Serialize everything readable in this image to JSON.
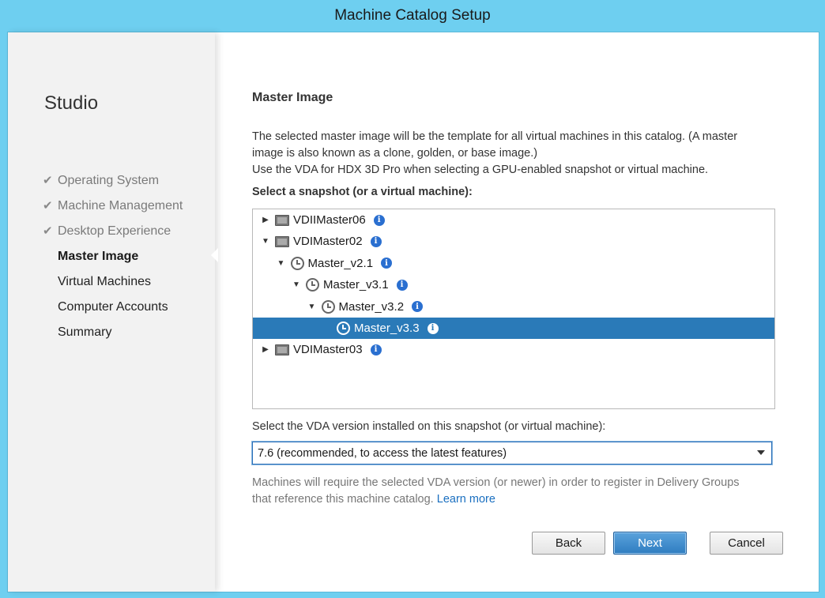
{
  "window": {
    "title": "Machine Catalog Setup"
  },
  "sidebar": {
    "app_name": "Studio",
    "steps": [
      {
        "label": "Operating System",
        "state": "done"
      },
      {
        "label": "Machine Management",
        "state": "done"
      },
      {
        "label": "Desktop Experience",
        "state": "done"
      },
      {
        "label": "Master Image",
        "state": "current"
      },
      {
        "label": "Virtual Machines",
        "state": "pending"
      },
      {
        "label": "Computer Accounts",
        "state": "pending"
      },
      {
        "label": "Summary",
        "state": "pending"
      }
    ]
  },
  "main": {
    "title": "Master Image",
    "description": [
      "The selected master image will be the template for all virtual machines in this catalog. (A master",
      "image is also known as a clone, golden, or base image.)",
      "Use the VDA for HDX 3D Pro when selecting a GPU-enabled snapshot or virtual machine."
    ],
    "tree_label": "Select a snapshot (or a virtual machine):",
    "tree": [
      {
        "label": "VDIIMaster06",
        "icon": "vm-icon",
        "expander": "collapsed",
        "depth": 0,
        "selected": false
      },
      {
        "label": "VDIMaster02",
        "icon": "vm-icon",
        "expander": "expanded",
        "depth": 0,
        "selected": false
      },
      {
        "label": "Master_v2.1",
        "icon": "snapshot-clock-icon",
        "expander": "expanded",
        "depth": 1,
        "selected": false
      },
      {
        "label": "Master_v3.1",
        "icon": "snapshot-clock-icon",
        "expander": "expanded",
        "depth": 2,
        "selected": false
      },
      {
        "label": "Master_v3.2",
        "icon": "snapshot-clock-icon",
        "expander": "expanded",
        "depth": 3,
        "selected": false
      },
      {
        "label": "Master_v3.3",
        "icon": "snapshot-clock-icon",
        "expander": "none",
        "depth": 4,
        "selected": true
      },
      {
        "label": "VDIMaster03",
        "icon": "vm-icon",
        "expander": "collapsed",
        "depth": 0,
        "selected": false
      }
    ],
    "vda_label": "Select the VDA version installed on this snapshot (or virtual machine):",
    "vda_selected": "7.6 (recommended, to access the latest features)",
    "note_line1": "Machines will require the selected VDA version (or newer) in order to register in Delivery Groups",
    "note_line2": "that reference this machine catalog.",
    "learn_more": "Learn more"
  },
  "buttons": {
    "back": "Back",
    "next": "Next",
    "cancel": "Cancel"
  },
  "colors": {
    "selection": "#2a7ab8",
    "frame": "#6ecff0",
    "link": "#1a6fc0",
    "info": "#2a6fd0"
  }
}
